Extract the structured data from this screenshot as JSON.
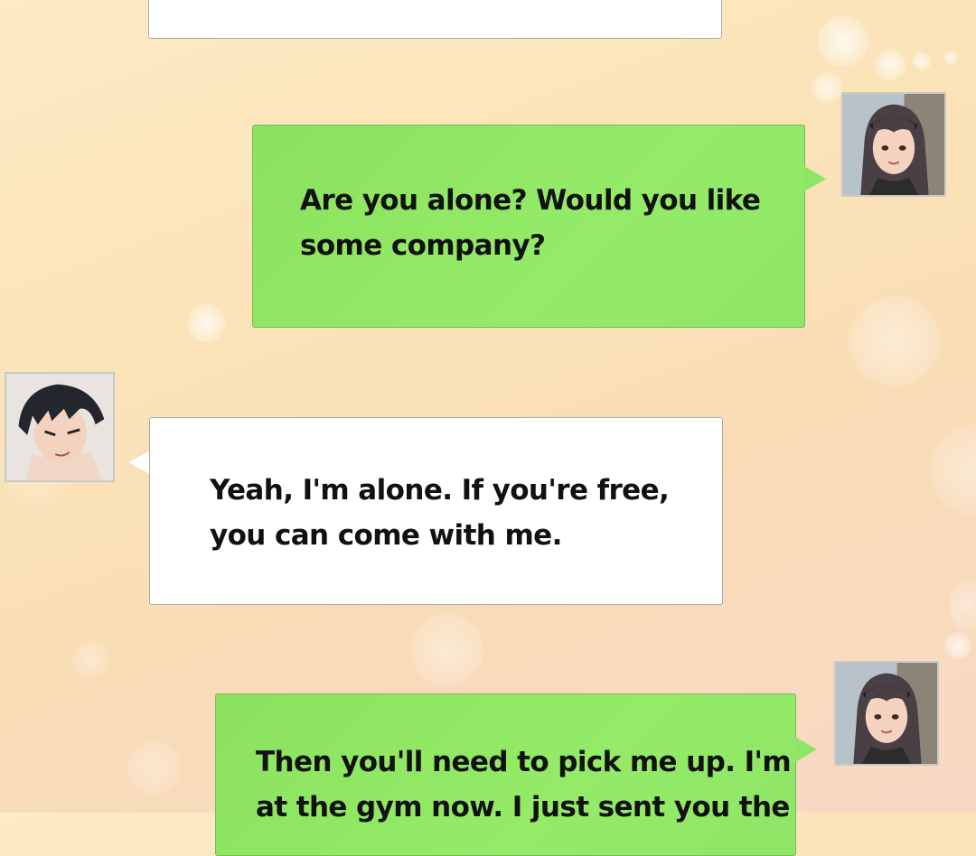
{
  "chat": {
    "messages": [
      {
        "sender": "partial",
        "text": ""
      },
      {
        "sender": "her",
        "text": "Are you alone? Would you like\nsome company?"
      },
      {
        "sender": "him",
        "text": "Yeah, I'm alone. If you're free,\nyou can come with me."
      },
      {
        "sender": "her",
        "text": "Then you'll need to pick me up. I'm\nat the gym now. I just sent you the"
      }
    ],
    "avatars": {
      "her": "woman-avatar-icon",
      "him": "man-avatar-icon"
    },
    "colors": {
      "green_bubble": "#8ae25e",
      "white_bubble": "#ffffff",
      "background": "#fbe3b8"
    }
  }
}
